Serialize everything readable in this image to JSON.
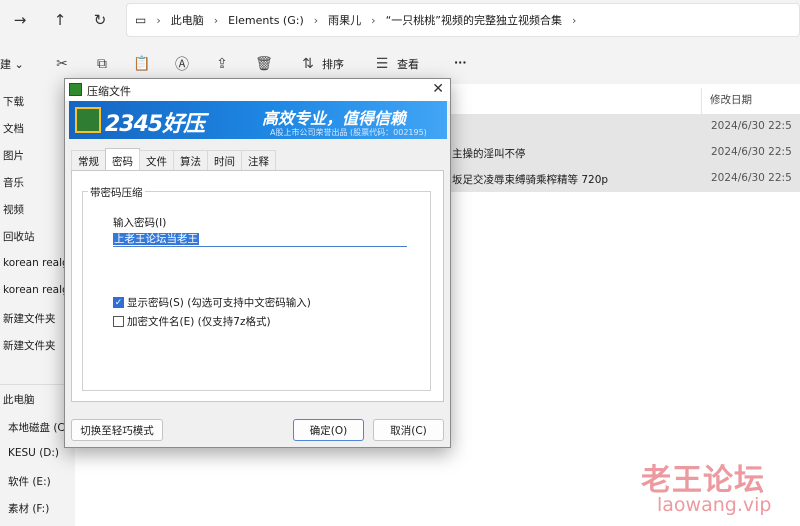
{
  "explorer": {
    "breadcrumb": [
      "此电脑",
      "Elements (G:)",
      "雨果儿",
      "“一只桃桃”视频的完整独立视频合集"
    ],
    "toolbar": {
      "new_label": "新建",
      "sort_label": "排序",
      "view_label": "查看",
      "more_label": "···"
    },
    "sidebar": [
      "下载",
      "文档",
      "图片",
      "音乐",
      "视频",
      "回收站",
      "korean realg",
      "korean realg",
      "新建文件夹",
      "新建文件夹",
      "此电脑",
      "本地磁盘 (C",
      "KESU (D:)",
      "软件 (E:)",
      "素材 (F:)"
    ],
    "list_header_date": "修改日期",
    "rows": [
      {
        "name": "",
        "date": "2024/6/30 22:5"
      },
      {
        "name": "主操的淫叫不停",
        "date": "2024/6/30 22:5"
      },
      {
        "name": "坂足交凌辱束缚骑乘榨精等 720p",
        "date": "2024/6/30 22:5"
      }
    ]
  },
  "dialog": {
    "title": "压缩文件",
    "banner_brand": "2345好压",
    "banner_slogan": "高效专业，值得信赖",
    "banner_sub": "A股上市公司荣誉出品 (股票代码：002195)",
    "tabs": [
      "常规",
      "密码",
      "文件",
      "算法",
      "时间",
      "注释"
    ],
    "active_tab": "密码",
    "group_label": "带密码压缩",
    "password_label": "输入密码(I)",
    "password_value": "上老王论坛当老王",
    "show_password_label": "显示密码(S) (勾选可支持中文密码输入)",
    "show_password_checked": true,
    "encrypt_names_label": "加密文件名(E) (仅支持7z格式)",
    "encrypt_names_checked": false,
    "switch_mode_button": "切换至轻巧模式",
    "ok_button": "确定(O)",
    "cancel_button": "取消(C)"
  },
  "watermark": {
    "line1": "老王论坛",
    "line2": "laowang.vip"
  },
  "colors": {
    "accent": "#2f6fd1",
    "banner": "#1e88e5",
    "watermark": "#dc4650"
  }
}
